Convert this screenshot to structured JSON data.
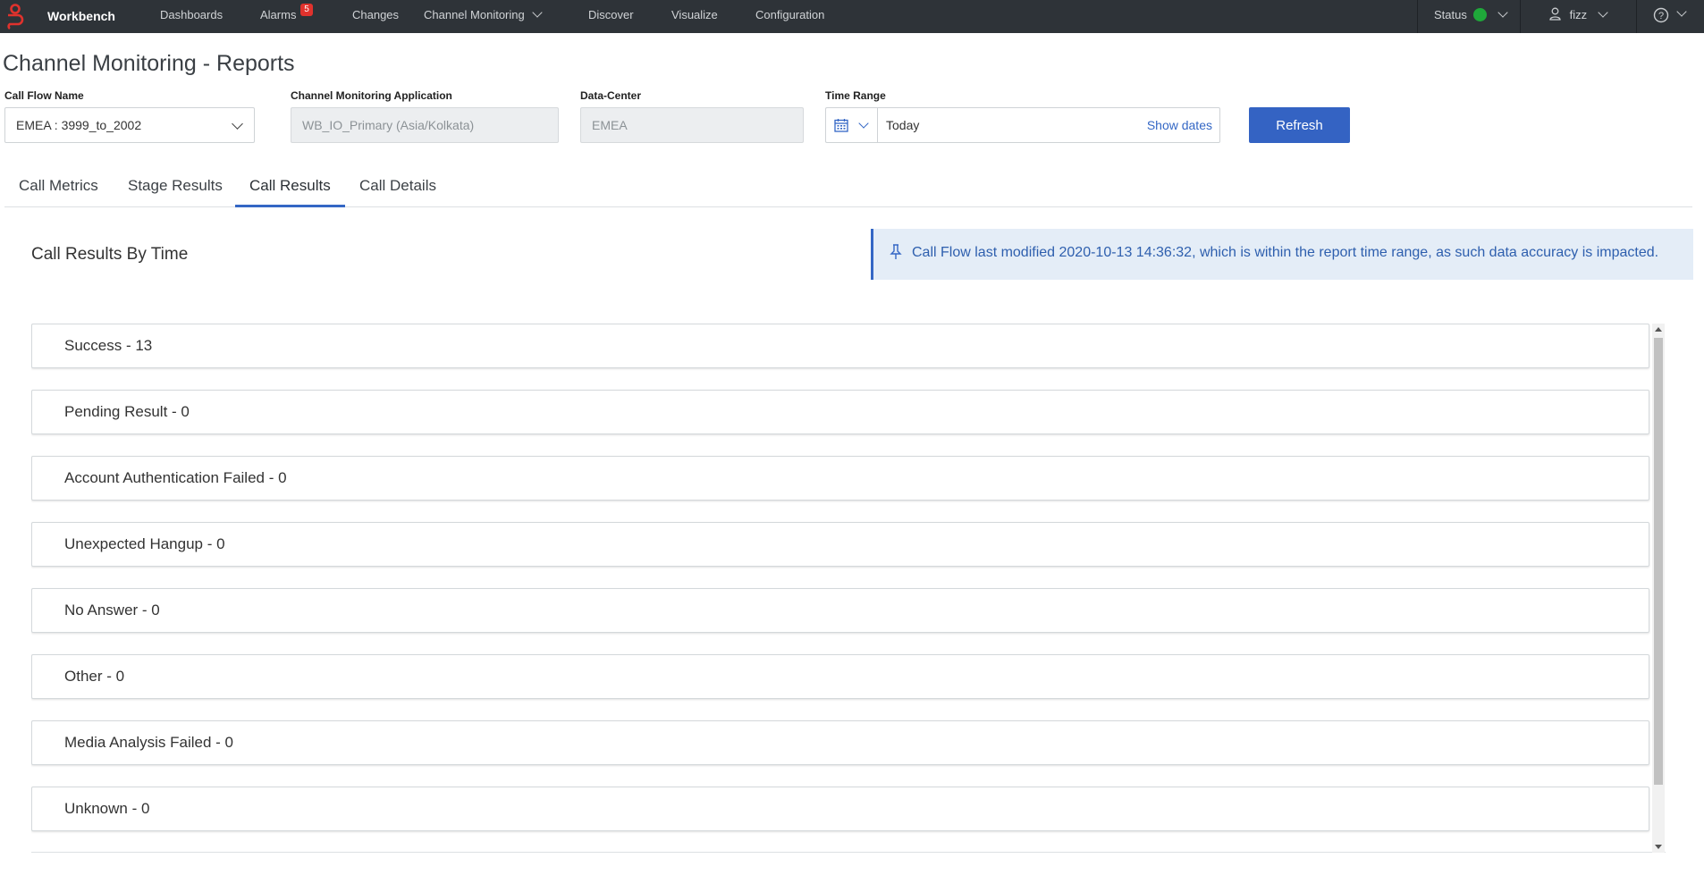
{
  "topnav": {
    "brand": "Workbench",
    "items": [
      {
        "label": "Dashboards"
      },
      {
        "label": "Alarms",
        "badge": "5"
      },
      {
        "label": "Changes"
      },
      {
        "label": "Channel Monitoring"
      },
      {
        "label": "Discover"
      },
      {
        "label": "Visualize"
      },
      {
        "label": "Configuration"
      }
    ],
    "status_label": "Status",
    "status_color": "#1fa83a",
    "user": "fizz",
    "help_icon": "question-circle-icon"
  },
  "page": {
    "title": "Channel Monitoring - Reports"
  },
  "filters": {
    "call_flow_label": "Call Flow Name",
    "call_flow_value": "EMEA : 3999_to_2002",
    "application_label": "Channel Monitoring Application",
    "application_value": "WB_IO_Primary (Asia/Kolkata)",
    "datacenter_label": "Data-Center",
    "datacenter_value": "EMEA",
    "time_range_label": "Time Range",
    "time_range_value": "Today",
    "show_dates": "Show dates",
    "refresh_label": "Refresh"
  },
  "tabs": [
    {
      "label": "Call Metrics"
    },
    {
      "label": "Stage Results"
    },
    {
      "label": "Call Results",
      "active": true
    },
    {
      "label": "Call Details"
    }
  ],
  "section": {
    "title": "Call Results By Time",
    "notice": "Call Flow last modified 2020-10-13 14:36:32, which is within the report time range, as such data accuracy is impacted."
  },
  "results": [
    {
      "label": "Success - 13"
    },
    {
      "label": "Pending Result - 0"
    },
    {
      "label": "Account Authentication Failed - 0"
    },
    {
      "label": "Unexpected Hangup - 0"
    },
    {
      "label": "No Answer - 0"
    },
    {
      "label": "Other - 0"
    },
    {
      "label": "Media Analysis Failed - 0"
    },
    {
      "label": "Unknown - 0"
    }
  ],
  "colors": {
    "accent": "#3467c5",
    "nav_bg": "#2e3338",
    "badge": "#e0322d"
  }
}
